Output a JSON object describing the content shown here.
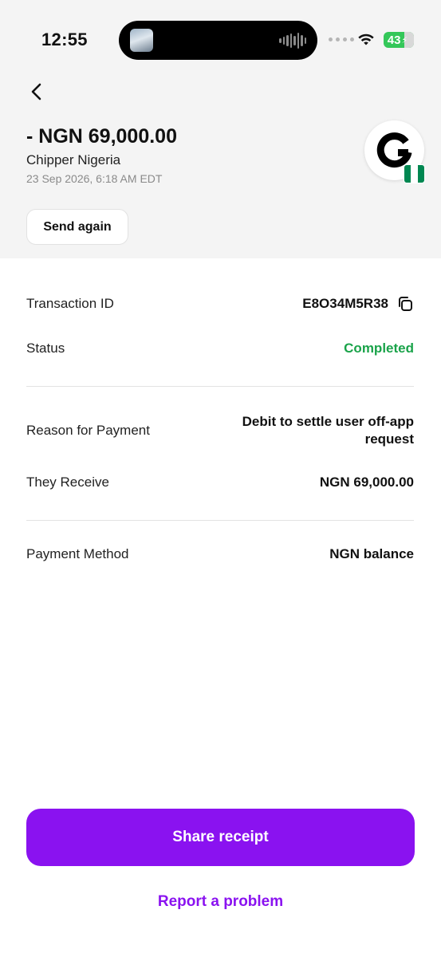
{
  "status_bar": {
    "time": "12:55",
    "battery": "43",
    "icons": [
      "dynamic-island-thumbnail",
      "audio-wave-icon",
      "signal-dots-icon",
      "wifi-icon",
      "battery-charging-icon"
    ]
  },
  "header": {
    "back_icon": "chevron-left-icon",
    "amount": "- NGN 69,000.00",
    "merchant": "Chipper Nigeria",
    "date": "23 Sep 2026, 6:18 AM EDT",
    "avatar_icon": "chipper-logo-icon",
    "flag_icon": "nigeria-flag-icon",
    "send_again_label": "Send again"
  },
  "details": {
    "transaction_id_label": "Transaction ID",
    "transaction_id_value": "E8O34M5R38",
    "copy_icon": "copy-icon",
    "status_label": "Status",
    "status_value": "Completed",
    "reason_label": "Reason for Payment",
    "reason_value_line1": "Debit to settle user off-app",
    "reason_value_line2": "request",
    "receive_label": "They Receive",
    "receive_value": "NGN 69,000.00",
    "method_label": "Payment Method",
    "method_value": "NGN balance"
  },
  "actions": {
    "share_label": "Share receipt",
    "report_label": "Report a problem"
  },
  "colors": {
    "accent": "#8a12f0",
    "status_green": "#1aa34a",
    "header_bg": "#f4f4f4",
    "flag_green": "#008751"
  }
}
